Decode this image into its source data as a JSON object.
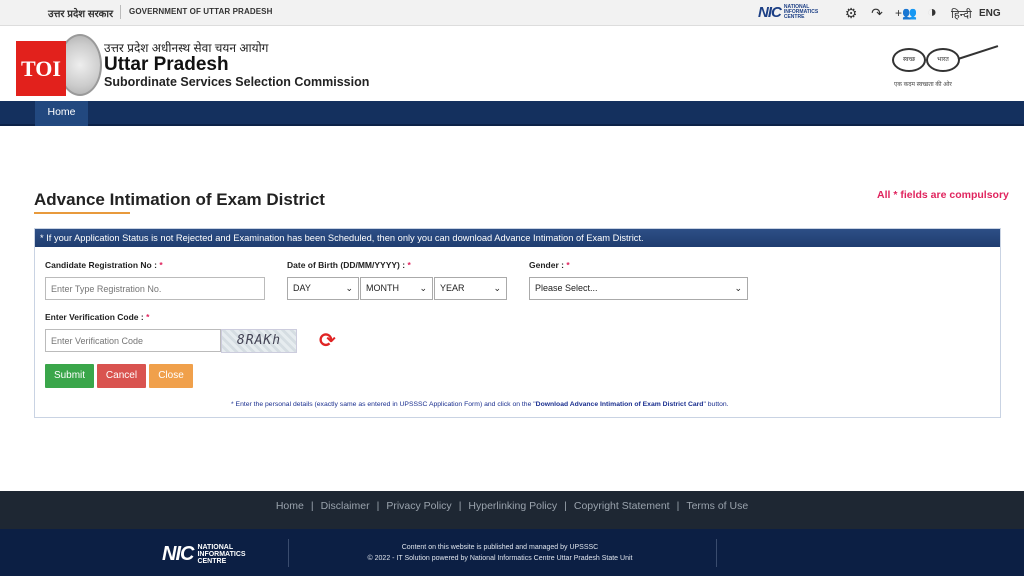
{
  "topbar": {
    "gov_hindi": "उत्तर प्रदेश सरकार",
    "gov_english": "GOVERNMENT OF UTTAR PRADESH",
    "nic_logo": "NIC",
    "nic_text": "NATIONAL INFORMATICS CENTRE",
    "icons": [
      "settings-icon",
      "screen-reader-icon",
      "accessibility-icon",
      "contrast-icon"
    ],
    "lang_hindi": "हिन्दी",
    "lang_english": "ENG"
  },
  "header": {
    "toi_badge": "TOI",
    "hindi_name": "उत्तर प्रदेश अधीनस्थ सेवा चयन आयोग",
    "title": "Uttar Pradesh",
    "subtitle": "Subordinate Services Selection Commission",
    "swachh_left": "स्वच्छ",
    "swachh_right": "भारत",
    "swachh_tagline": "एक कदम स्वच्छता की ओर"
  },
  "nav": {
    "home": "Home"
  },
  "page": {
    "title": "Advance Intimation of Exam District",
    "compulsory_note": "All * fields are compulsory",
    "panel_notice": "* If your Application Status is not Rejected and Examination has been Scheduled, then only you can download Advance Intimation of Exam District."
  },
  "form": {
    "reg_label": "Candidate Registration No :",
    "reg_placeholder": "Enter Type Registration No.",
    "dob_label": "Date of Birth (DD/MM/YYYY) :",
    "dob_day": "DAY",
    "dob_month": "MONTH",
    "dob_year": "YEAR",
    "gender_label": "Gender :",
    "gender_value": "Please Select...",
    "verify_label": "Enter Verification Code :",
    "verify_placeholder": "Enter Verification Code",
    "captcha_text": "8RAKh",
    "required_mark": "*",
    "submit": "Submit",
    "cancel": "Cancel",
    "close": "Close",
    "note_start": "* Enter the personal details (exactly same as entered in UPSSSC Application Form) and click on the \"",
    "note_link": "Download Advance Intimation of Exam District Card",
    "note_end": "\" button."
  },
  "colors": {
    "nav_bg": "#14305e",
    "submit": "#3aa64a",
    "cancel": "#d9534f",
    "close": "#f0a04b",
    "required": "#e0245e"
  },
  "footer": {
    "links": [
      "Home",
      "Disclaimer",
      "Privacy Policy",
      "Hyperlinking Policy",
      "Copyright Statement",
      "Terms of Use"
    ],
    "separator": "|",
    "nic_logo": "NIC",
    "nic_text": "NATIONAL INFORMATICS CENTRE",
    "content_line1": "Content on this website is published and managed by UPSSSC",
    "content_line2": "© 2022 - IT Solution powered by National Informatics Centre Uttar Pradesh State Unit"
  }
}
